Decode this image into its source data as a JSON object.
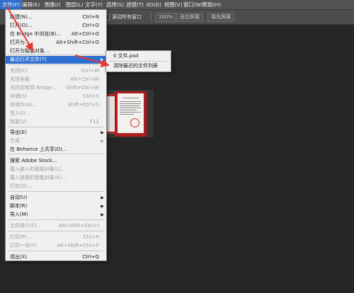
{
  "menubar": {
    "items": [
      "文件(F)",
      "编辑(E)",
      "图像(I)",
      "图层(L)",
      "文字(Y)",
      "选择(S)",
      "滤镜(T)",
      "3D(D)",
      "视图(V)",
      "窗口(W)",
      "帮助(H)"
    ],
    "active_index": 0
  },
  "options_bar": {
    "scroll_all_windows_label": "滚动所有窗口",
    "buttons": [
      "100%",
      "适合屏幕",
      "填充屏幕"
    ]
  },
  "file_menu": {
    "items": [
      {
        "label": "新建(N)...",
        "shortcut": "Ctrl+N",
        "enabled": true
      },
      {
        "label": "打开(O)...",
        "shortcut": "Ctrl+O",
        "enabled": true
      },
      {
        "label": "在 Bridge 中浏览(B)...",
        "shortcut": "Alt+Ctrl+O",
        "enabled": true
      },
      {
        "label": "打开为...",
        "shortcut": "Alt+Shift+Ctrl+O",
        "enabled": true
      },
      {
        "label": "打开为智能对象...",
        "shortcut": "",
        "enabled": true
      },
      {
        "label": "最近打开文件(T)",
        "shortcut": "",
        "enabled": true,
        "submenu": true,
        "highlighted": true
      },
      {
        "label": "关闭(C)",
        "shortcut": "Ctrl+W",
        "enabled": false
      },
      {
        "label": "关闭全部",
        "shortcut": "Alt+Ctrl+W",
        "enabled": false
      },
      {
        "label": "关闭并转到 Bridge...",
        "shortcut": "Shift+Ctrl+W",
        "enabled": false
      },
      {
        "label": "存储(S)",
        "shortcut": "Ctrl+S",
        "enabled": false
      },
      {
        "label": "存储为(A)...",
        "shortcut": "Shift+Ctrl+S",
        "enabled": false
      },
      {
        "label": "签入(I)...",
        "shortcut": "",
        "enabled": false
      },
      {
        "label": "恢复(V)",
        "shortcut": "F12",
        "enabled": false
      },
      {
        "label": "导出(E)",
        "shortcut": "",
        "enabled": true,
        "submenu": true
      },
      {
        "label": "生成",
        "shortcut": "",
        "enabled": false,
        "submenu": true
      },
      {
        "label": "在 Behance 上共享(D)...",
        "shortcut": "",
        "enabled": true
      },
      {
        "label": "搜索 Adobe Stock...",
        "shortcut": "",
        "enabled": true
      },
      {
        "label": "置入嵌入的智能对象(L)...",
        "shortcut": "",
        "enabled": false
      },
      {
        "label": "置入链接的智能对象(K)...",
        "shortcut": "",
        "enabled": false
      },
      {
        "label": "打包(G)...",
        "shortcut": "",
        "enabled": false
      },
      {
        "label": "自动(U)",
        "shortcut": "",
        "enabled": true,
        "submenu": true
      },
      {
        "label": "脚本(R)",
        "shortcut": "",
        "enabled": true,
        "submenu": true
      },
      {
        "label": "导入(M)",
        "shortcut": "",
        "enabled": true,
        "submenu": true
      },
      {
        "label": "文件简介(F)...",
        "shortcut": "Alt+Shift+Ctrl+I",
        "enabled": false
      },
      {
        "label": "打印(P)...",
        "shortcut": "Ctrl+P",
        "enabled": false
      },
      {
        "label": "打印一份(Y)",
        "shortcut": "Alt+Shift+Ctrl+P",
        "enabled": false
      },
      {
        "label": "退出(X)",
        "shortcut": "Ctrl+Q",
        "enabled": true
      }
    ]
  },
  "recent_submenu": {
    "items": [
      {
        "label": "0  文件.psd"
      },
      {
        "label": "清除最近的文件列表"
      }
    ]
  },
  "colors": {
    "annotation_arrow": "#e53935",
    "highlight": "#2f6fd0",
    "document_border": "#b01c1c"
  }
}
